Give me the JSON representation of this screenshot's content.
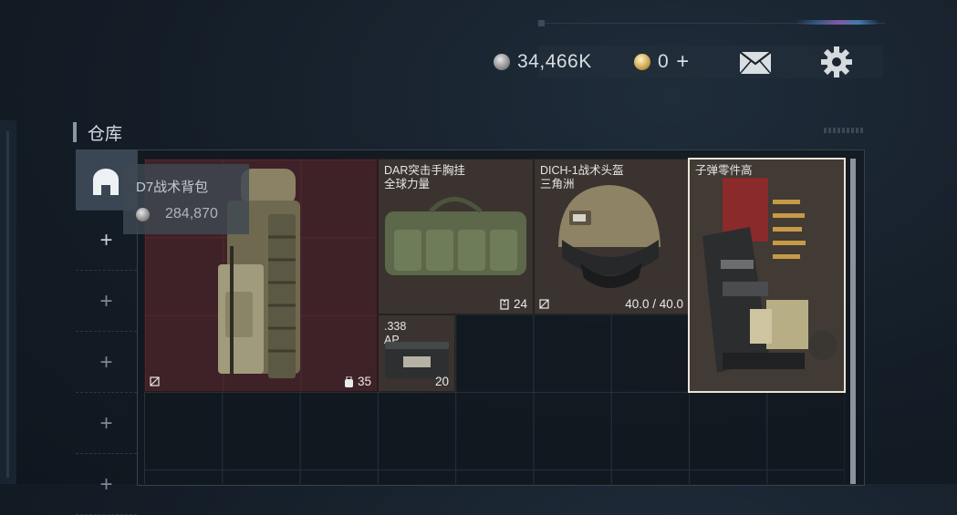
{
  "header": {
    "silver_value": "34,466K",
    "gold_value": "0",
    "add_label": "+",
    "icons": [
      "silver-coin-icon",
      "gold-coin-icon",
      "plus-icon",
      "mail-icon",
      "gear-icon"
    ]
  },
  "storage": {
    "title": "仓库",
    "tabs": [
      {
        "icon": "storage-home-icon",
        "active": true
      },
      {
        "label": "+"
      },
      {
        "label": "+"
      },
      {
        "label": "+"
      },
      {
        "label": "+"
      },
      {
        "label": "+"
      }
    ]
  },
  "tooltip": {
    "name": "D7战术背包",
    "price": "284,870"
  },
  "items": [
    {
      "name": "",
      "count": "35",
      "count_icon": "backpack-capacity-icon"
    },
    {
      "name": "DAR突击手胸挂\n全球力量",
      "count": "24",
      "count_icon": "vest-capacity-icon"
    },
    {
      "name": "DICH-1战术头盔\n三角洲",
      "count": "40.0 / 40.0"
    },
    {
      "name": ".338\nAP",
      "count": "20"
    },
    {
      "name": "子弹零件高"
    }
  ],
  "colors": {
    "backpack_bg": "#3f2227",
    "item_bg": "#3b3330",
    "selected_border": "#e9e4d8"
  }
}
